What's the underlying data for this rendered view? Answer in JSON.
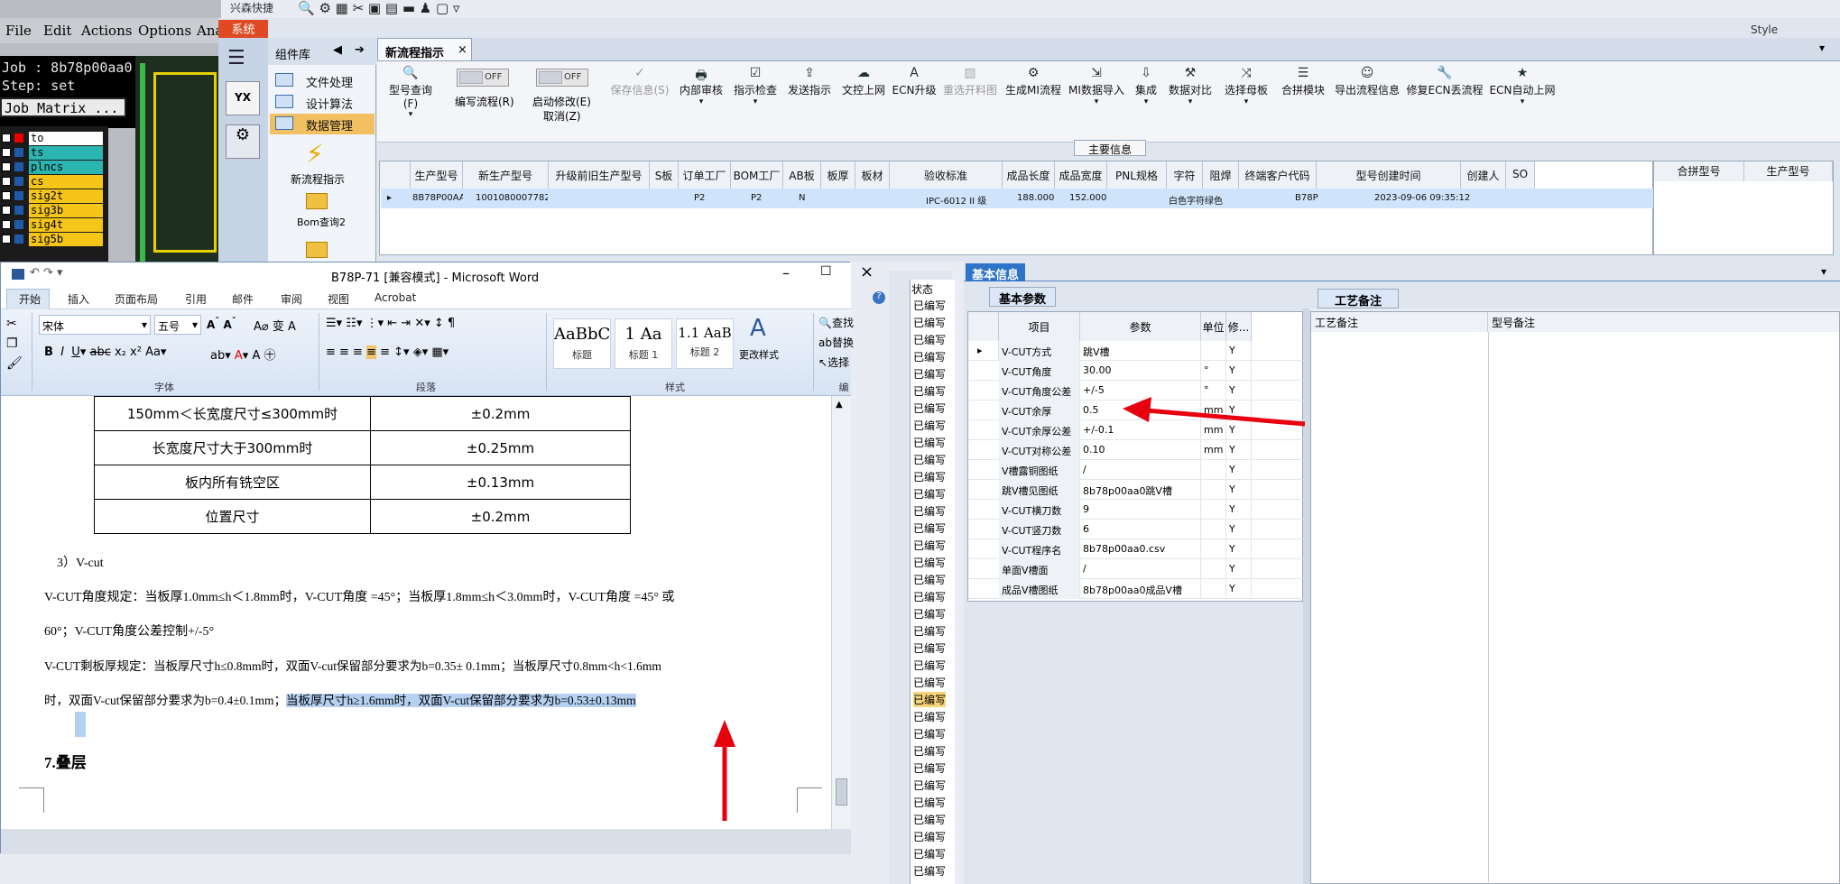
{
  "left_app": {
    "menu": [
      "File",
      "Edit",
      "Actions",
      "Options",
      "Ana"
    ],
    "job_line": "Job : 8b78p00aa0",
    "step_line": "Step: set",
    "job_matrix": "Job Matrix ...",
    "layers": [
      "to",
      "ts",
      "plncs",
      "cs",
      "sig2t",
      "sig3b",
      "sig4t",
      "sig5b"
    ]
  },
  "erp": {
    "top_title": "兴森快捷",
    "system_tab": "系统",
    "style_label": "Style",
    "sidebar_header": "组件库",
    "sidebar_items": [
      "文件处理",
      "设计算法",
      "数据管理"
    ],
    "sidebar_shortcuts": [
      "新流程指示",
      "Bom查询2"
    ],
    "active_tab": "新流程指示",
    "toolbar": {
      "btn1": "型号查询(F)",
      "btn2": "编写流程(R)",
      "btn3": "启动修改(E)",
      "btn3b": "取消(Z)",
      "btn4": "保存信息(S)",
      "toggle_off": "OFF",
      "items": [
        "内部审核",
        "指示检查",
        "发送指示",
        "文控上网",
        "ECN升级",
        "重选开料图",
        "生成MI流程",
        "MI数据导入",
        "集成",
        "数据对比",
        "选择母板",
        "合拼模块",
        "导出流程信息",
        "修复ECN丢流程",
        "ECN自动上网"
      ]
    },
    "main_info_label": "主要信息",
    "grid_headers": [
      "生产型号",
      "新生产型号",
      "升级前旧生产型号",
      "S板",
      "订单工厂",
      "BOM工厂",
      "AB板",
      "板厚",
      "板材",
      "验收标准",
      "成品长度",
      "成品宽度",
      "PNL规格",
      "字符",
      "阻焊",
      "终端客户代码",
      "型号创建时间",
      "创建人",
      "SO"
    ],
    "grid_row": [
      "8B78P00AA0",
      "10010800077823",
      "",
      "",
      "P2",
      "P2",
      "N",
      "",
      "",
      "IPC-6012 II 级",
      "188.000",
      "152.000",
      "",
      "白色字符",
      "绿色",
      "B78P",
      "2023-09-06 09:35:12",
      "",
      ""
    ],
    "grid2_headers": [
      "合拼型号",
      "生产型号"
    ]
  },
  "word": {
    "title": "B78P-71 [兼容模式] - Microsoft Word",
    "tabs": [
      "开始",
      "插入",
      "页面布局",
      "引用",
      "邮件",
      "审阅",
      "视图",
      "Acrobat"
    ],
    "font_name": "宋体",
    "font_size": "五号",
    "group_labels": [
      "字体",
      "段落",
      "样式",
      "编辑"
    ],
    "styles": [
      {
        "preview": "AaBbC",
        "name": "标题"
      },
      {
        "preview": "1 Aa",
        "name": "标题 1"
      },
      {
        "preview": "1.1 AaB",
        "name": "标题 2"
      }
    ],
    "change_styles": "更改样式",
    "edit_items": [
      "查找",
      "替换",
      "选择"
    ],
    "table_rows": [
      [
        "150mm＜长宽度尺寸≤300mm时",
        "±0.2mm"
      ],
      [
        "长宽度尺寸大于300mm时",
        "±0.25mm"
      ],
      [
        "板内所有铣空区",
        "±0.13mm"
      ],
      [
        "位置尺寸",
        "±0.2mm"
      ]
    ],
    "p_heading": "3）V-cut",
    "p1": "V-CUT角度规定：当板厚1.0mm≤h＜1.8mm时，V-CUT角度 =45°；当板厚1.8mm≤h＜3.0mm时，V-CUT角度 =45° 或",
    "p1b": "60°；V-CUT角度公差控制+/-5°",
    "p2": "V-CUT剩板厚规定：当板厚尺寸h≤0.8mm时，双面V-cut保留部分要求为b=0.35± 0.1mm；当板厚尺寸0.8mm<h<1.6mm",
    "p3a": "时，双面V-cut保留部分要求为b=0.4±0.1mm；",
    "p3b": "当板厚尺寸h≥1.6mm时，双面V-cut保留部分要求为b=0.53±0.13mm",
    "p_section": "7.叠层"
  },
  "status_col": {
    "header": "状态",
    "value": "已编写",
    "count": 34
  },
  "info_panel": {
    "tab": "基本信息",
    "subtab": "基本参数",
    "headers": [
      "项目",
      "参数",
      "单位",
      "修..."
    ],
    "rows": [
      [
        "V-CUT方式",
        "跳V槽",
        "",
        "Y"
      ],
      [
        "V-CUT角度",
        "30.00",
        "°",
        "Y"
      ],
      [
        "V-CUT角度公差",
        "+/-5",
        "°",
        "Y"
      ],
      [
        "V-CUT余厚",
        "0.5",
        "mm",
        "Y"
      ],
      [
        "V-CUT余厚公差",
        "+/-0.1",
        "mm",
        "Y"
      ],
      [
        "V-CUT对称公差",
        "0.10",
        "mm",
        "Y"
      ],
      [
        "V槽露铜图纸",
        "/",
        "",
        "Y"
      ],
      [
        "跳V槽见图纸",
        "8b78p00aa0跳V槽",
        "",
        "Y"
      ],
      [
        "V-CUT横刀数",
        "9",
        "",
        "Y"
      ],
      [
        "V-CUT竖刀数",
        "6",
        "",
        "Y"
      ],
      [
        "V-CUT程序名",
        "8b78p00aa0.csv",
        "",
        "Y"
      ],
      [
        "单面V槽面",
        "/",
        "",
        "Y"
      ],
      [
        "成品V槽图纸",
        "8b78p00aa0成品V槽",
        "",
        "Y"
      ]
    ],
    "process_tab": "工艺备注",
    "col_a": "工艺备注",
    "col_b": "型号备注"
  },
  "colors": {
    "annotation_red": "#e8000f",
    "selection_blue": "#b5d1f1",
    "accent_blue": "#2e73c7"
  }
}
